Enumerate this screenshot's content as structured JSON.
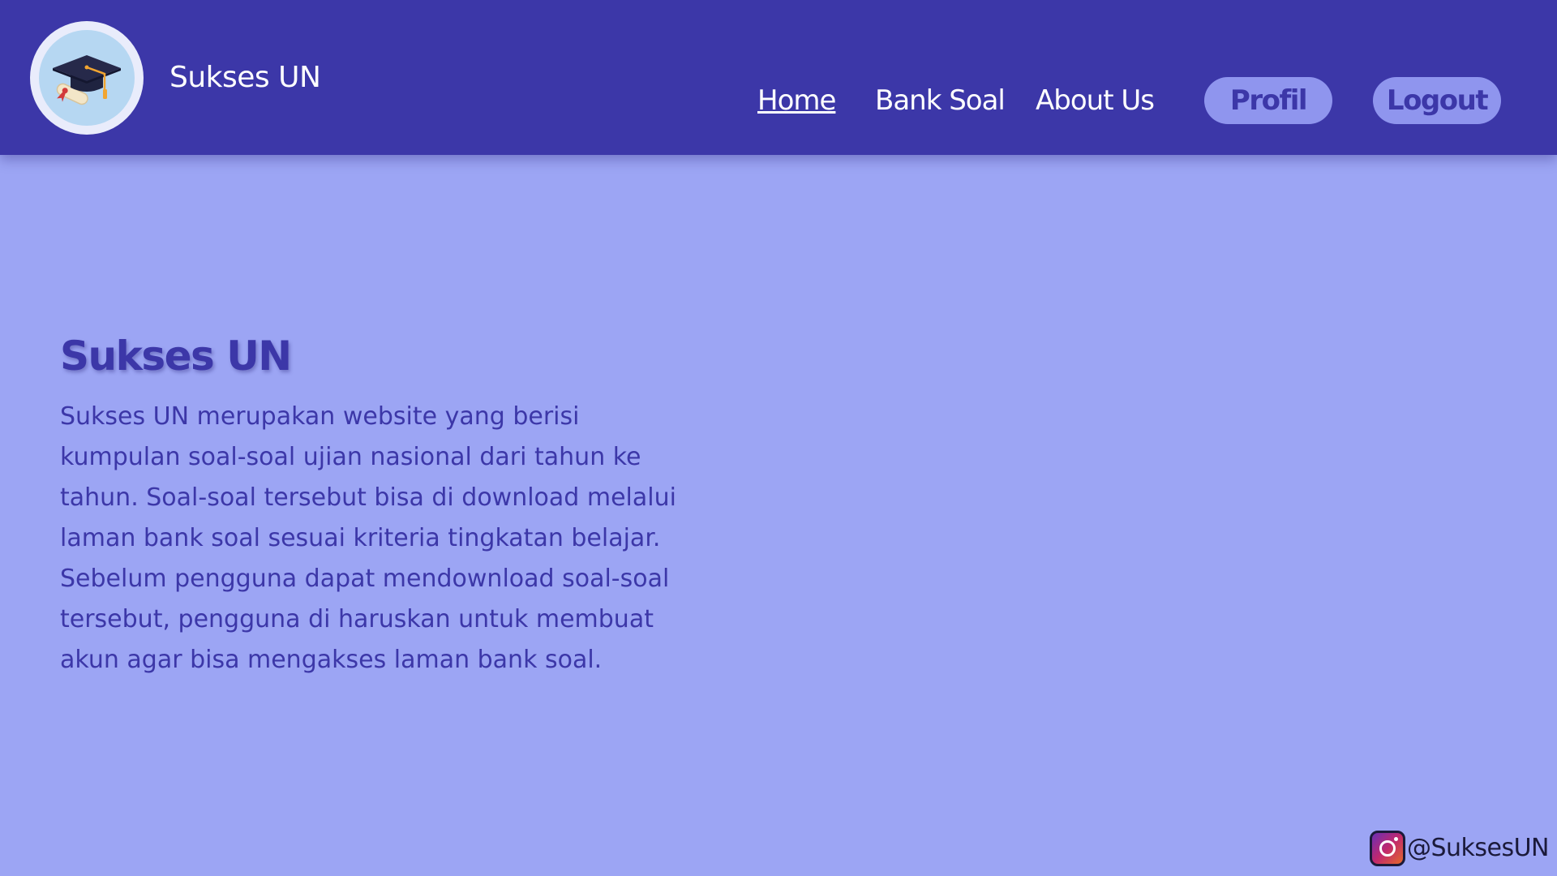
{
  "header": {
    "brand": "Sukses UN",
    "nav": {
      "home": "Home",
      "bank_soal": "Bank Soal",
      "about_us": "About Us"
    },
    "profil_button": "Profil",
    "logout_button": "Logout"
  },
  "hero": {
    "title": "Sukses UN",
    "description": "Sukses UN merupakan website yang berisi kumpulan soal-soal ujian nasional dari tahun ke tahun. Soal-soal tersebut bisa di download melalui laman bank soal sesuai kriteria tingkatan belajar. Sebelum pengguna dapat mendownload soal-soal tersebut, pengguna di haruskan untuk membuat akun agar bisa mengakses laman bank soal."
  },
  "footer": {
    "social_icon": "instagram-icon",
    "social_handle": "@SuksesUN"
  },
  "colors": {
    "header_bg": "#3c37a8",
    "page_bg": "#9ca5f4",
    "pill_bg": "#8f95ee",
    "text_primary": "#3c37a8"
  },
  "icons": {
    "logo": "graduation-cap-icon"
  }
}
